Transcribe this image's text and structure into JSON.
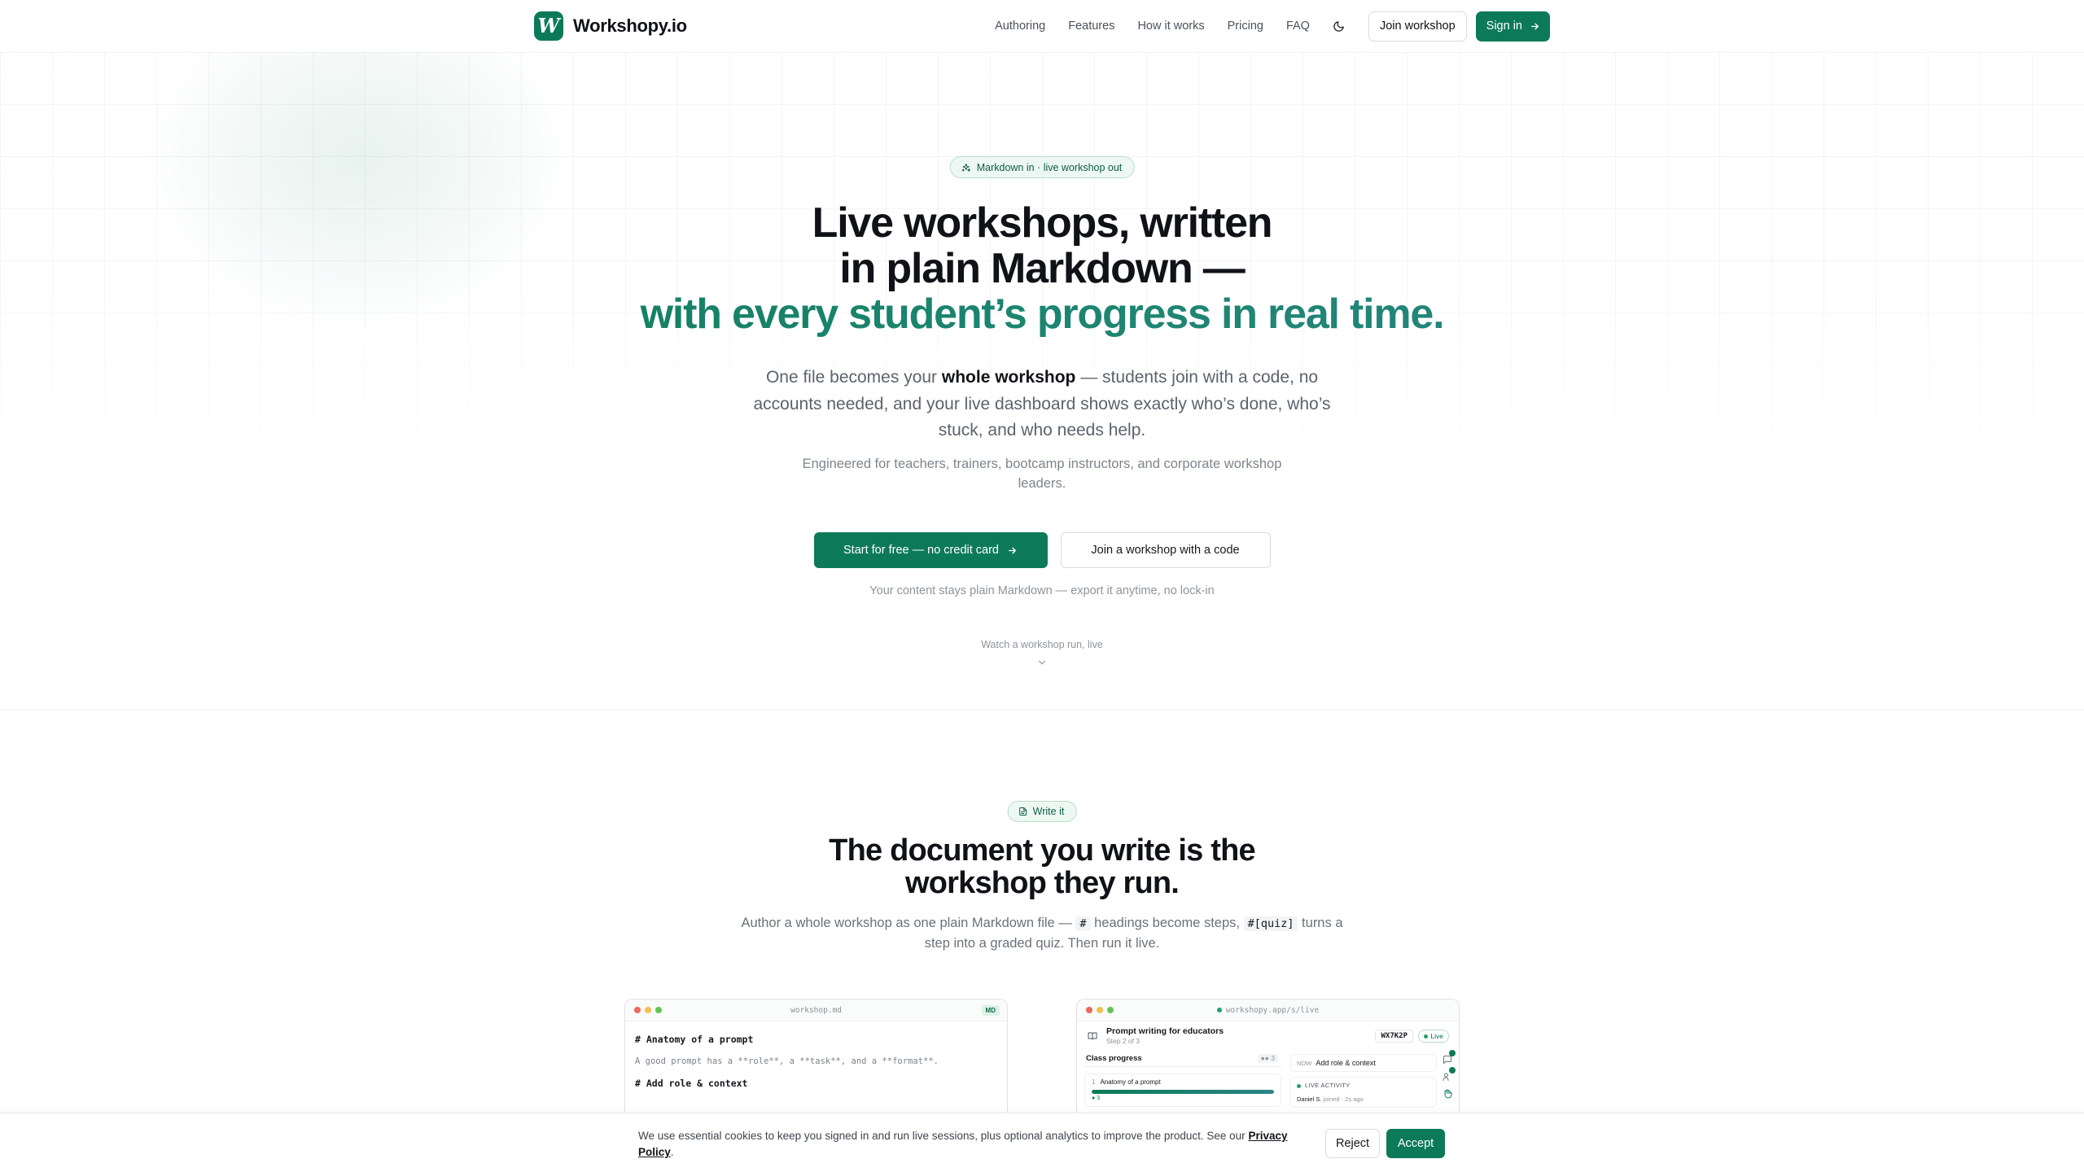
{
  "nav": {
    "brand": "Workshopy.io",
    "logo_letter": "W",
    "links": [
      "Authoring",
      "Features",
      "How it works",
      "Pricing",
      "FAQ"
    ],
    "join_button": "Join workshop",
    "signin_button": "Sign in"
  },
  "hero": {
    "pill": "Markdown in · live workshop out",
    "title_line1": "Live workshops, written",
    "title_line2": "in plain Markdown —",
    "title_line3": "with every student’s progress in real time.",
    "sub_before": "One file becomes your ",
    "sub_bold": "whole workshop",
    "sub_after": " — students join with a code, no accounts needed, and your live dashboard shows exactly who’s done, who’s stuck, and who needs help.",
    "audience": "Engineered for teachers, trainers, bootcamp instructors, and corporate workshop leaders.",
    "cta_primary": "Start for free — no credit card",
    "cta_secondary": "Join a workshop with a code",
    "cta_note": "Your content stays plain Markdown — export it anytime, no lock-in",
    "watch_label": "Watch a workshop run, live"
  },
  "write_section": {
    "pill": "Write it",
    "title_line1": "The document you write is the",
    "title_line2": "workshop they run.",
    "sub_part1": "Author a whole workshop as one plain Markdown file — ",
    "sub_code1": "#",
    "sub_part2": " headings become steps, ",
    "sub_code2": "#[quiz]",
    "sub_part3": " turns a step into a graded quiz. Then run it live."
  },
  "editor_window": {
    "filename": "workshop.md",
    "badge": "MD",
    "lines": [
      {
        "kind": "h",
        "text": "# Anatomy of a prompt"
      },
      {
        "kind": "p",
        "text": "A good prompt has a **role**, a **task**, and a **format**."
      },
      {
        "kind": "h",
        "text": "# Add role & context"
      }
    ]
  },
  "live_window": {
    "url": "workshopy.app/s/live",
    "title": "Prompt writing for educators",
    "step": "Step 2 of 3",
    "join_code": "WX7K2P",
    "live_label": "Live",
    "class_progress_label": "Class progress",
    "student_count": "3",
    "progress_rows": [
      {
        "num": "1",
        "label": "Anatomy of a prompt",
        "progress": 1.0,
        "mini": "● 3"
      }
    ],
    "now_prefix": "NOW",
    "now_step": "Add role & context",
    "activity_label": "LIVE ACTIVITY",
    "activity_item_name": "Daniel S.",
    "activity_item_action": "joined · 2s ago",
    "rail_badges": [
      "3",
      "1"
    ]
  },
  "cookie": {
    "text": "We use essential cookies to keep you signed in and run live sessions, plus optional analytics to improve the product. See our ",
    "link": "Privacy Policy",
    "after_link": ".",
    "reject": "Reject",
    "accept": "Accept"
  },
  "colors": {
    "brand": "#0c7a58",
    "accent_teal": "#2b8585",
    "pill_bg": "#eef8f3",
    "mac_red": "#ec6a5e",
    "mac_yellow": "#f4bf4f",
    "mac_green": "#61c554"
  },
  "icons": {
    "theme_toggle": "moon-icon",
    "signin_arrow": "arrow-right-icon",
    "pill": "sparkles-icon",
    "write_pill": "document-icon",
    "watch": "chevron-down-icon"
  }
}
